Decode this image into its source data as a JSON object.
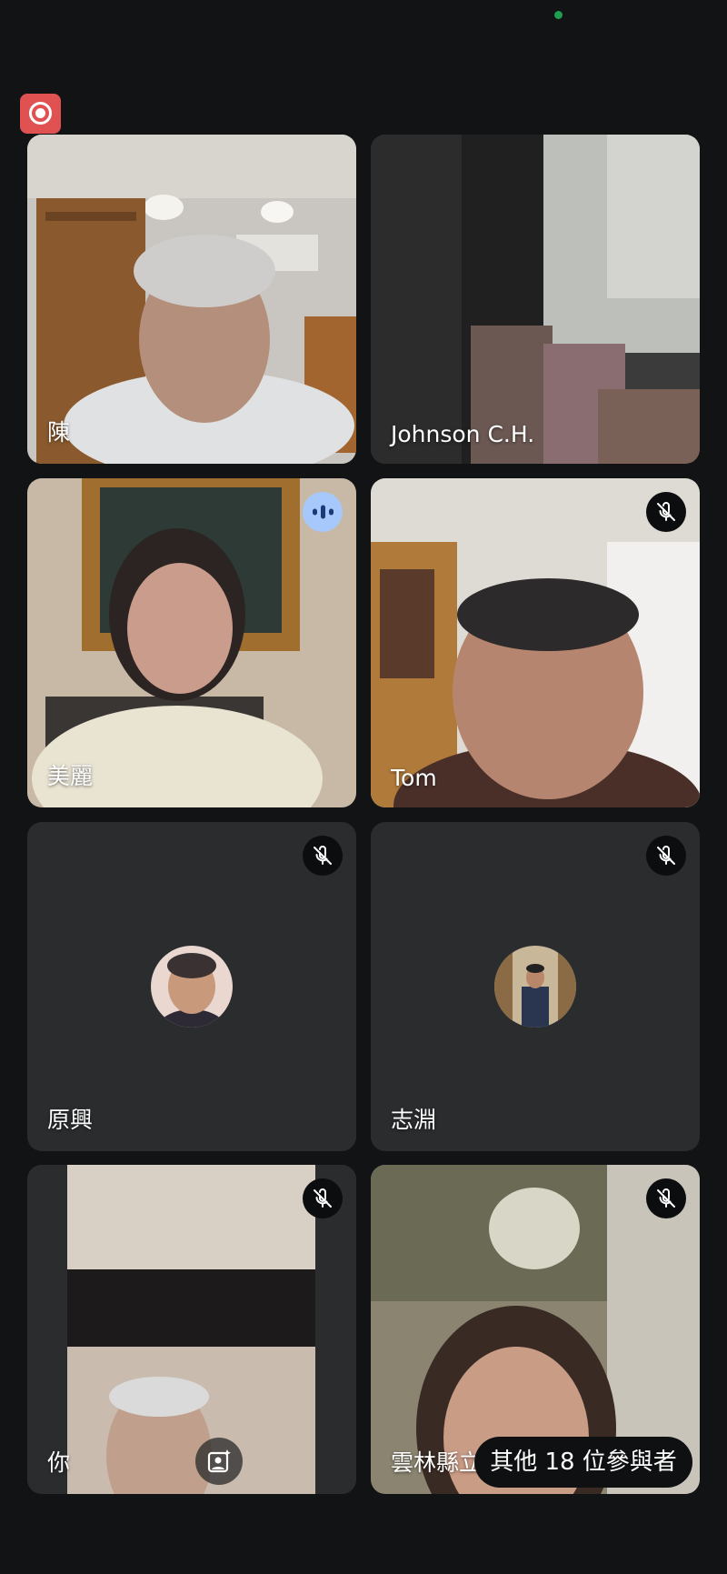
{
  "status": {
    "recording_icon": "record-icon"
  },
  "participants": [
    {
      "name": "陳",
      "muted": false,
      "speaking": false
    },
    {
      "name": "Johnson C.H.",
      "muted": false,
      "speaking": false
    },
    {
      "name": "美麗",
      "muted": false,
      "speaking": true
    },
    {
      "name": "Tom",
      "muted": true,
      "speaking": false
    },
    {
      "name": "原興",
      "muted": true,
      "speaking": false
    },
    {
      "name": "志淵",
      "muted": true,
      "speaking": false
    },
    {
      "name": "你",
      "muted": true,
      "speaking": false
    },
    {
      "name": "雲林縣立",
      "muted": true,
      "speaking": false
    }
  ],
  "overflow": {
    "label": "其他 18 位參與者"
  },
  "colors": {
    "background": "#121314",
    "tile": "#2a2c2e",
    "recording": "#e05252",
    "speaking": "#a7c8fa"
  }
}
